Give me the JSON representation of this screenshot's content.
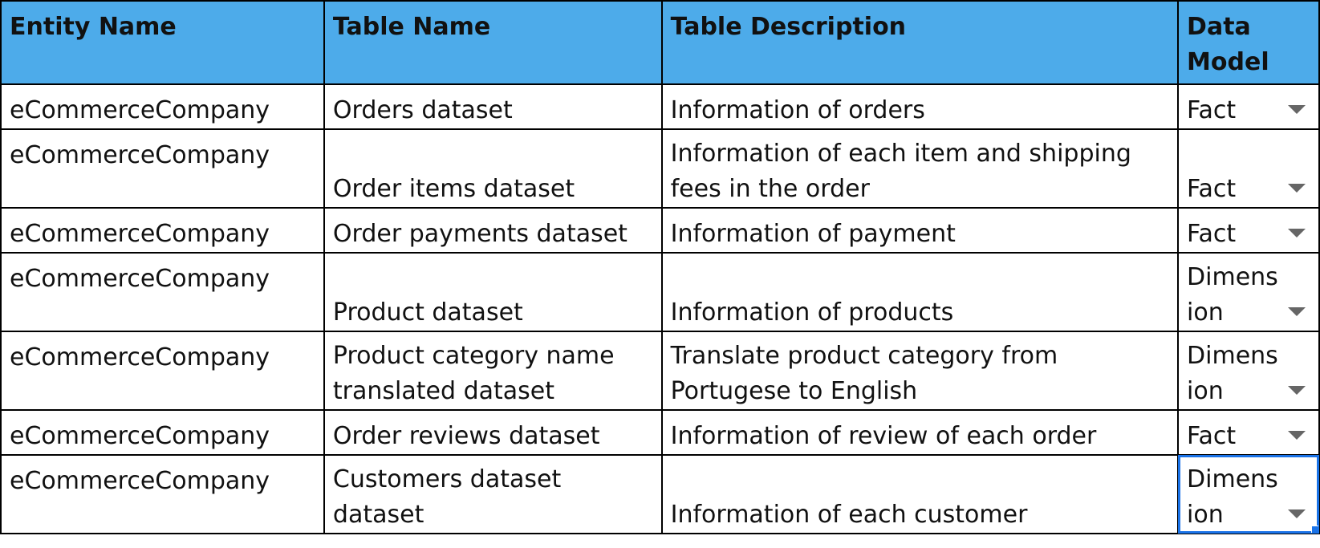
{
  "columns": [
    "Entity Name",
    "Table Name",
    "Table Description",
    "Data Model"
  ],
  "rows": [
    {
      "entity": "eCommerceCompany",
      "table": "Orders dataset",
      "description": "Information of orders",
      "model": "Fact"
    },
    {
      "entity": "eCommerceCompany",
      "table": "Order items dataset",
      "description": "Information of each item and shipping fees in the order",
      "model": "Fact"
    },
    {
      "entity": "eCommerceCompany",
      "table": "Order payments dataset",
      "description": "Information of payment",
      "model": "Fact"
    },
    {
      "entity": "eCommerceCompany",
      "table": "Product dataset",
      "description": "Information of products",
      "model": "Dimension"
    },
    {
      "entity": "eCommerceCompany",
      "table": "Product category name translated dataset",
      "description": "Translate product category from Portugese to English",
      "model": "Dimension"
    },
    {
      "entity": "eCommerceCompany",
      "table": "Order reviews dataset",
      "description": "Information of review of each order",
      "model": "Fact"
    },
    {
      "entity": "eCommerceCompany",
      "table": "Customers dataset dataset",
      "description": "Information of each customer",
      "model": "Dimension"
    }
  ],
  "selected_row": 6,
  "colors": {
    "header_bg": "#4dabea",
    "selection": "#1a73e8",
    "grid": "#000000"
  },
  "icons": {
    "dropdown": "chevron-down-icon"
  }
}
